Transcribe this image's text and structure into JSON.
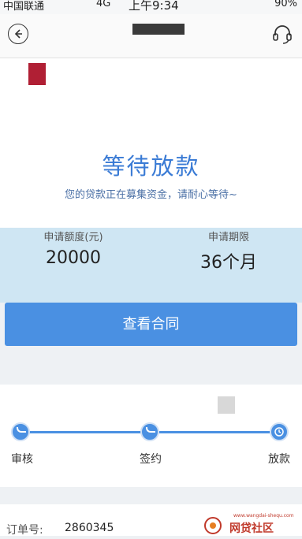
{
  "status_bar": {
    "carrier": "中国联通",
    "network": "4G",
    "time": "上午9:34",
    "battery": "90%"
  },
  "nav": {
    "back_icon": "back-arrow-icon",
    "support_icon": "headset-icon"
  },
  "status": {
    "title": "等待放款",
    "subtitle": "您的贷款正在募集资金，请耐心等待~"
  },
  "loan_info": {
    "amount_label": "申请额度(元)",
    "amount_value": "20000",
    "term_label": "申请期限",
    "term_value": "36个月"
  },
  "actions": {
    "view_contract": "查看合同"
  },
  "progress": {
    "steps": [
      {
        "label": "审核",
        "state": "done"
      },
      {
        "label": "签约",
        "state": "done"
      },
      {
        "label": "放款",
        "state": "current"
      }
    ]
  },
  "order": {
    "label": "订单号:",
    "value": "2860345"
  },
  "watermark": {
    "text": "网贷社区",
    "url": "www.wangdai-shequ.com"
  }
}
